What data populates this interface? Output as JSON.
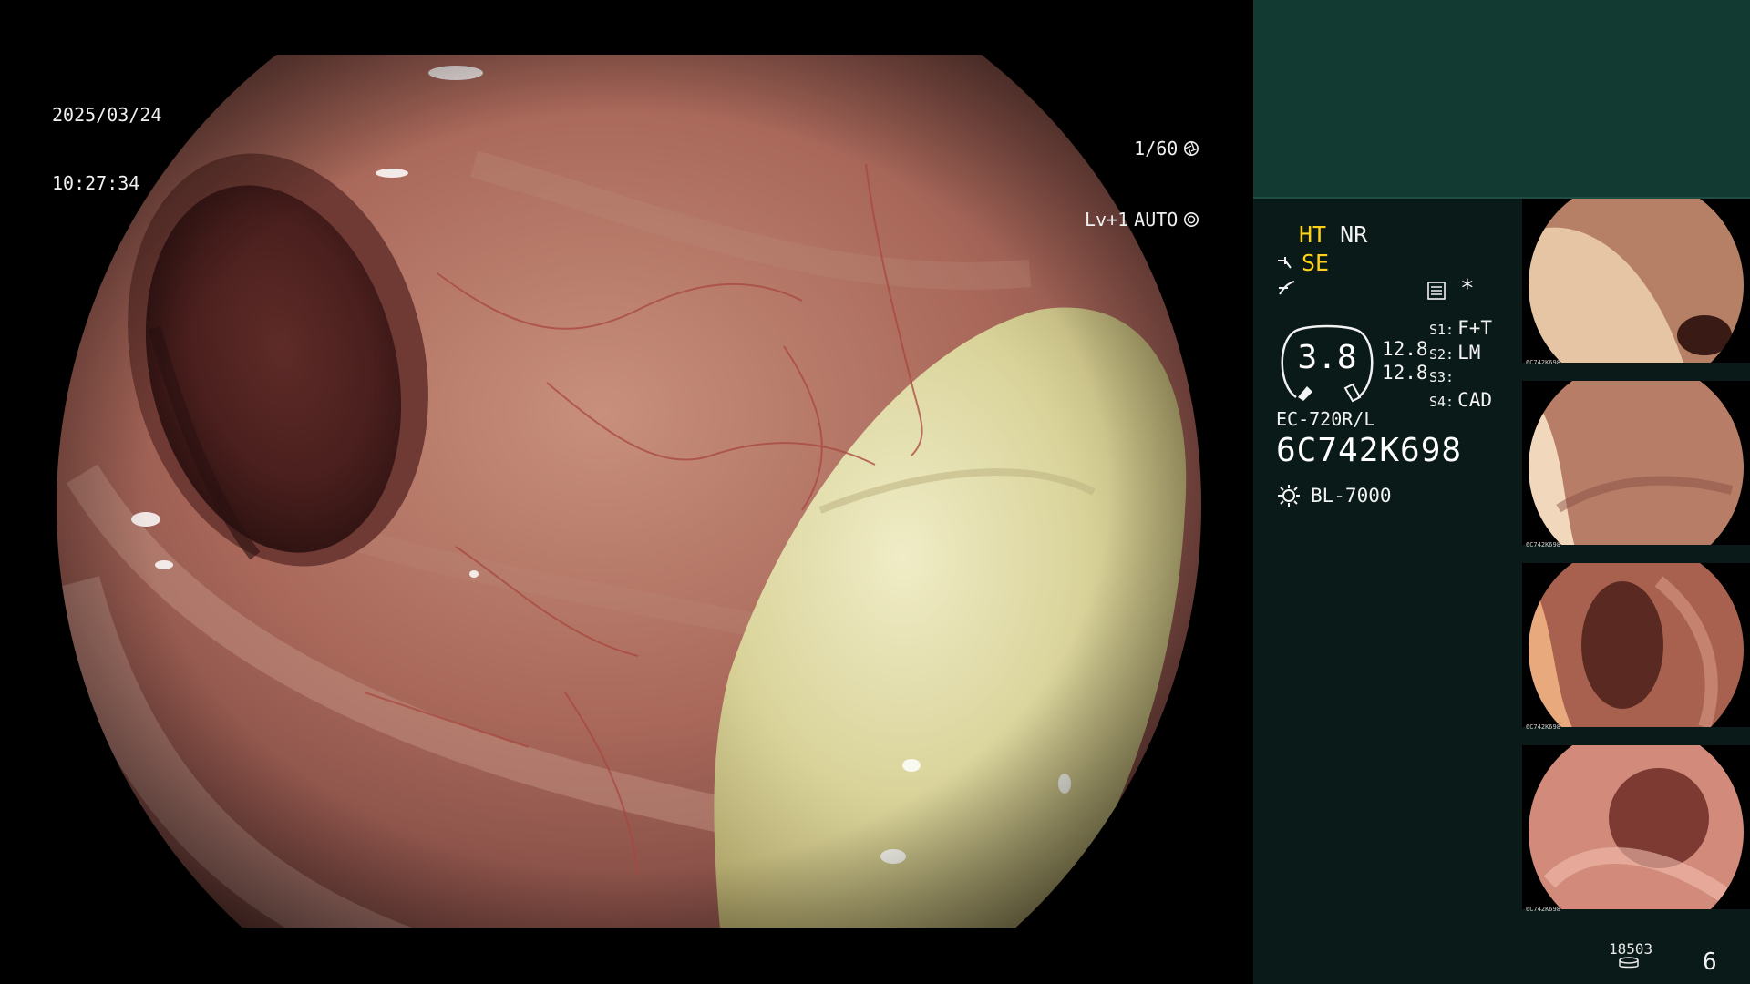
{
  "osd": {
    "date": "2025/03/24",
    "time": "10:27:34",
    "shutter": "1/60",
    "shutter_icon": "aperture-icon",
    "brightness": "Lv+1",
    "iris_mode": "AUTO",
    "iris_icon": "iris-icon"
  },
  "panel": {
    "ht": "HT",
    "nr": "NR",
    "se": "SE",
    "settings_icon": "menu-settings-icon",
    "star": "*",
    "gauge_value": "3.8",
    "gain_top": "12.8",
    "gain_bottom": "12.8",
    "slots": [
      {
        "key": "S1:",
        "value": "F+T"
      },
      {
        "key": "S2:",
        "value": "LM"
      },
      {
        "key": "S3:",
        "value": ""
      },
      {
        "key": "S4:",
        "value": "CAD"
      }
    ],
    "scope_model": "EC-720R/L",
    "scope_serial": "6C742K698",
    "light_source": "BL-7000",
    "light_icon": "sun-icon"
  },
  "thumbnails": [
    {
      "name": "thumbnail-1",
      "serial": "6C742K698"
    },
    {
      "name": "thumbnail-2",
      "serial": "6C742K698"
    },
    {
      "name": "thumbnail-3",
      "serial": "6C742K698"
    },
    {
      "name": "thumbnail-4",
      "serial": "6C742K698"
    }
  ],
  "footer": {
    "count": "18503",
    "index": "6"
  },
  "colors": {
    "panel_bg": "#0a1a18",
    "panel_header": "#123a33",
    "highlight": "#ffd21a"
  }
}
